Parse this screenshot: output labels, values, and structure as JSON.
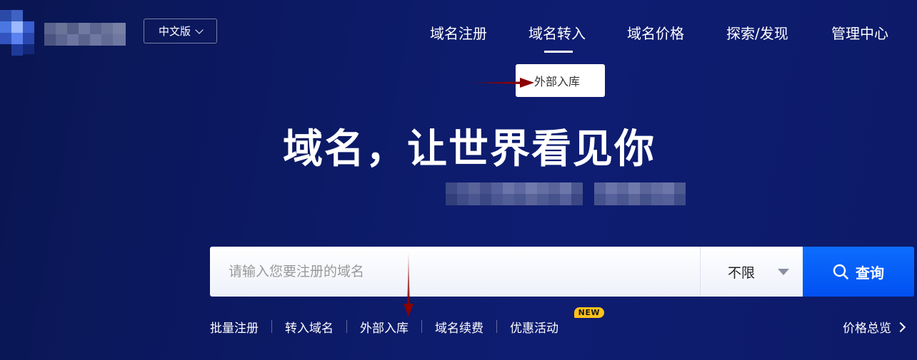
{
  "header": {
    "language_label": "中文版",
    "nav": [
      {
        "label": "域名注册"
      },
      {
        "label": "域名转入"
      },
      {
        "label": "域名价格"
      },
      {
        "label": "探索/发现"
      },
      {
        "label": "管理中心"
      }
    ],
    "active_nav": "域名转入",
    "dropdown_item": "外部入库"
  },
  "hero": {
    "title": "域名，让世界看见你"
  },
  "search": {
    "placeholder": "请输入您要注册的域名",
    "filter_value": "不限",
    "button_label": "查询"
  },
  "quick_links": {
    "items": [
      "批量注册",
      "转入域名",
      "外部入库",
      "域名续费",
      "优惠活动"
    ],
    "badge": "NEW",
    "price_overview": "价格总览"
  },
  "colors": {
    "background": "#0c1a66",
    "search_button": "#0050f0",
    "badge": "#ffc21a",
    "annotation_arrow": "#8b0000"
  }
}
